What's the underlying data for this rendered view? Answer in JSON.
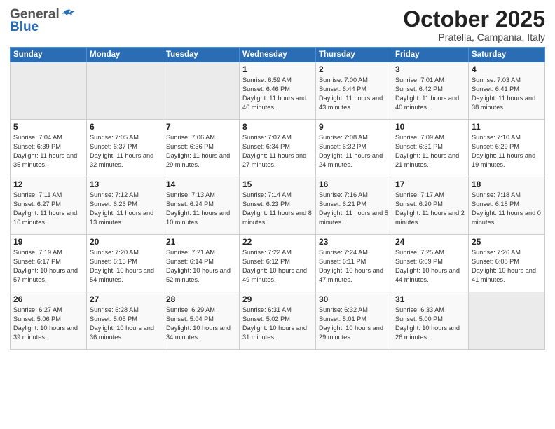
{
  "header": {
    "logo_general": "General",
    "logo_blue": "Blue",
    "month_title": "October 2025",
    "subtitle": "Pratella, Campania, Italy"
  },
  "weekdays": [
    "Sunday",
    "Monday",
    "Tuesday",
    "Wednesday",
    "Thursday",
    "Friday",
    "Saturday"
  ],
  "weeks": [
    [
      {
        "day": "",
        "empty": true
      },
      {
        "day": "",
        "empty": true
      },
      {
        "day": "",
        "empty": true
      },
      {
        "day": "1",
        "sunrise": "6:59 AM",
        "sunset": "6:46 PM",
        "daylight": "11 hours and 46 minutes."
      },
      {
        "day": "2",
        "sunrise": "7:00 AM",
        "sunset": "6:44 PM",
        "daylight": "11 hours and 43 minutes."
      },
      {
        "day": "3",
        "sunrise": "7:01 AM",
        "sunset": "6:42 PM",
        "daylight": "11 hours and 40 minutes."
      },
      {
        "day": "4",
        "sunrise": "7:03 AM",
        "sunset": "6:41 PM",
        "daylight": "11 hours and 38 minutes."
      }
    ],
    [
      {
        "day": "5",
        "sunrise": "7:04 AM",
        "sunset": "6:39 PM",
        "daylight": "11 hours and 35 minutes."
      },
      {
        "day": "6",
        "sunrise": "7:05 AM",
        "sunset": "6:37 PM",
        "daylight": "11 hours and 32 minutes."
      },
      {
        "day": "7",
        "sunrise": "7:06 AM",
        "sunset": "6:36 PM",
        "daylight": "11 hours and 29 minutes."
      },
      {
        "day": "8",
        "sunrise": "7:07 AM",
        "sunset": "6:34 PM",
        "daylight": "11 hours and 27 minutes."
      },
      {
        "day": "9",
        "sunrise": "7:08 AM",
        "sunset": "6:32 PM",
        "daylight": "11 hours and 24 minutes."
      },
      {
        "day": "10",
        "sunrise": "7:09 AM",
        "sunset": "6:31 PM",
        "daylight": "11 hours and 21 minutes."
      },
      {
        "day": "11",
        "sunrise": "7:10 AM",
        "sunset": "6:29 PM",
        "daylight": "11 hours and 19 minutes."
      }
    ],
    [
      {
        "day": "12",
        "sunrise": "7:11 AM",
        "sunset": "6:27 PM",
        "daylight": "11 hours and 16 minutes."
      },
      {
        "day": "13",
        "sunrise": "7:12 AM",
        "sunset": "6:26 PM",
        "daylight": "11 hours and 13 minutes."
      },
      {
        "day": "14",
        "sunrise": "7:13 AM",
        "sunset": "6:24 PM",
        "daylight": "11 hours and 10 minutes."
      },
      {
        "day": "15",
        "sunrise": "7:14 AM",
        "sunset": "6:23 PM",
        "daylight": "11 hours and 8 minutes."
      },
      {
        "day": "16",
        "sunrise": "7:16 AM",
        "sunset": "6:21 PM",
        "daylight": "11 hours and 5 minutes."
      },
      {
        "day": "17",
        "sunrise": "7:17 AM",
        "sunset": "6:20 PM",
        "daylight": "11 hours and 2 minutes."
      },
      {
        "day": "18",
        "sunrise": "7:18 AM",
        "sunset": "6:18 PM",
        "daylight": "11 hours and 0 minutes."
      }
    ],
    [
      {
        "day": "19",
        "sunrise": "7:19 AM",
        "sunset": "6:17 PM",
        "daylight": "10 hours and 57 minutes."
      },
      {
        "day": "20",
        "sunrise": "7:20 AM",
        "sunset": "6:15 PM",
        "daylight": "10 hours and 54 minutes."
      },
      {
        "day": "21",
        "sunrise": "7:21 AM",
        "sunset": "6:14 PM",
        "daylight": "10 hours and 52 minutes."
      },
      {
        "day": "22",
        "sunrise": "7:22 AM",
        "sunset": "6:12 PM",
        "daylight": "10 hours and 49 minutes."
      },
      {
        "day": "23",
        "sunrise": "7:24 AM",
        "sunset": "6:11 PM",
        "daylight": "10 hours and 47 minutes."
      },
      {
        "day": "24",
        "sunrise": "7:25 AM",
        "sunset": "6:09 PM",
        "daylight": "10 hours and 44 minutes."
      },
      {
        "day": "25",
        "sunrise": "7:26 AM",
        "sunset": "6:08 PM",
        "daylight": "10 hours and 41 minutes."
      }
    ],
    [
      {
        "day": "26",
        "sunrise": "6:27 AM",
        "sunset": "5:06 PM",
        "daylight": "10 hours and 39 minutes."
      },
      {
        "day": "27",
        "sunrise": "6:28 AM",
        "sunset": "5:05 PM",
        "daylight": "10 hours and 36 minutes."
      },
      {
        "day": "28",
        "sunrise": "6:29 AM",
        "sunset": "5:04 PM",
        "daylight": "10 hours and 34 minutes."
      },
      {
        "day": "29",
        "sunrise": "6:31 AM",
        "sunset": "5:02 PM",
        "daylight": "10 hours and 31 minutes."
      },
      {
        "day": "30",
        "sunrise": "6:32 AM",
        "sunset": "5:01 PM",
        "daylight": "10 hours and 29 minutes."
      },
      {
        "day": "31",
        "sunrise": "6:33 AM",
        "sunset": "5:00 PM",
        "daylight": "10 hours and 26 minutes."
      },
      {
        "day": "",
        "empty": true
      }
    ]
  ]
}
